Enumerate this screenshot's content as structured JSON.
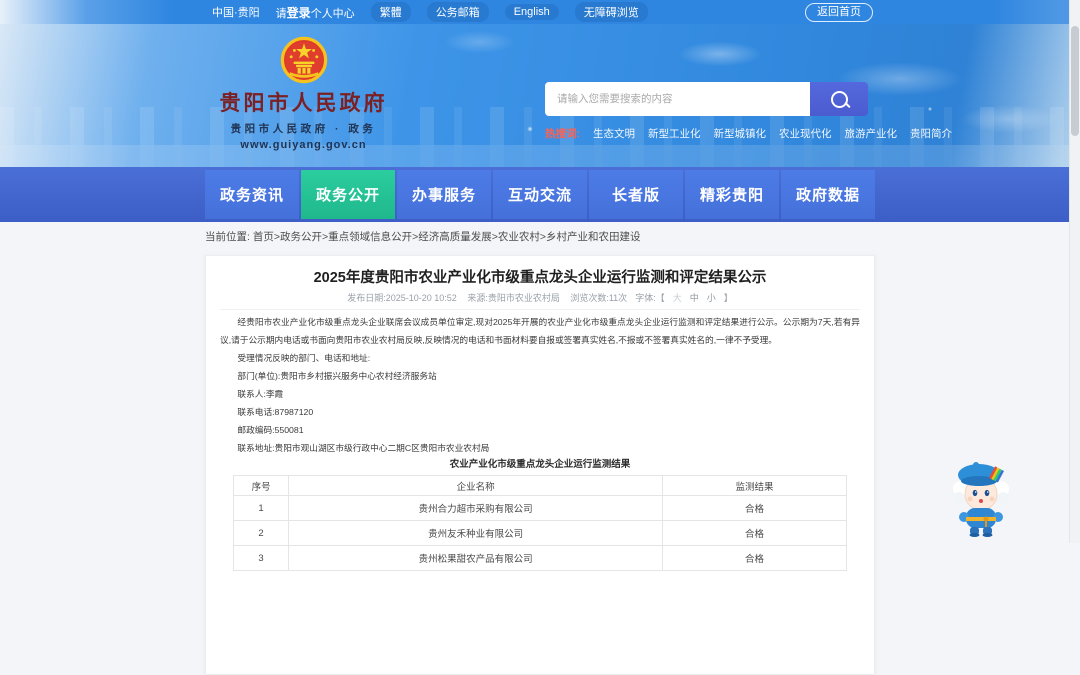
{
  "topbar": {
    "region": "中国·贵阳",
    "login_prefix": "请",
    "login_strong": "登录",
    "login_suffix": "个人中心",
    "traditional": "繁體",
    "mail": "公务邮箱",
    "english": "English",
    "accessibility": "无障碍浏览",
    "back_home": "返回首页"
  },
  "header": {
    "site_title": "贵阳市人民政府",
    "site_subtitle": "贵阳市人民政府 · 政务",
    "site_url": "www.guiyang.gov.cn",
    "search_placeholder": "请输入您需要搜索的内容",
    "hot_label": "热搜词:",
    "hot_words": [
      "生态文明",
      "新型工业化",
      "新型城镇化",
      "农业现代化",
      "旅游产业化",
      "贵阳简介"
    ]
  },
  "nav": {
    "items": [
      {
        "label": "政务资讯",
        "active": false
      },
      {
        "label": "政务公开",
        "active": true
      },
      {
        "label": "办事服务",
        "active": false
      },
      {
        "label": "互动交流",
        "active": false
      },
      {
        "label": "长者版",
        "active": false
      },
      {
        "label": "精彩贵阳",
        "active": false
      },
      {
        "label": "政府数据",
        "active": false
      }
    ]
  },
  "breadcrumb": {
    "label": "当前位置:",
    "path": "首页>政务公开>重点领域信息公开>经济高质量发展>农业农村>乡村产业和农田建设"
  },
  "article": {
    "title": "2025年度贵阳市农业产业化市级重点龙头企业运行监测和评定结果公示",
    "meta": {
      "publish": "发布日期:2025-10-20 10:52",
      "source": "来源:贵阳市农业农村局",
      "views": "浏览次数:11次",
      "font_label": "字体:【",
      "font_large": "大",
      "font_mid": "中",
      "font_small": "小",
      "font_close": "】"
    },
    "paragraphs": [
      "经贵阳市农业产业化市级重点龙头企业联席会议成员单位审定,现对2025年开展的农业产业化市级重点龙头企业运行监测和评定结果进行公示。公示期为7天,若有异议,请于公示期内电话或书面向贵阳市农业农村局反映,反映情况的电话和书面材料要自报或签署真实姓名,不报或不签署真实姓名的,一律不予受理。",
      "受理情况反映的部门、电话和地址:",
      "部门(单位):贵阳市乡村振兴服务中心农村经济服务站",
      "联系人:李霞",
      "联系电话:87987120",
      "邮政编码:550081",
      "联系地址:贵阳市观山湖区市级行政中心二期C区贵阳市农业农村局"
    ],
    "table": {
      "caption": "农业产业化市级重点龙头企业运行监测结果",
      "headers": [
        "序号",
        "企业名称",
        "监测结果"
      ],
      "rows": [
        [
          "1",
          "贵州合力超市采购有限公司",
          "合格"
        ],
        [
          "2",
          "贵州友禾种业有限公司",
          "合格"
        ],
        [
          "3",
          "贵州松果甜农产品有限公司",
          "合格"
        ]
      ]
    }
  },
  "colors": {
    "topbar_blue": "#2f86e0",
    "nav_blue": "#4a6fd6",
    "nav_active_green": "#25c296",
    "search_button_indigo": "#4f5fd5",
    "hot_label_red": "#ff6152",
    "site_title_maroon": "#7b2023"
  }
}
